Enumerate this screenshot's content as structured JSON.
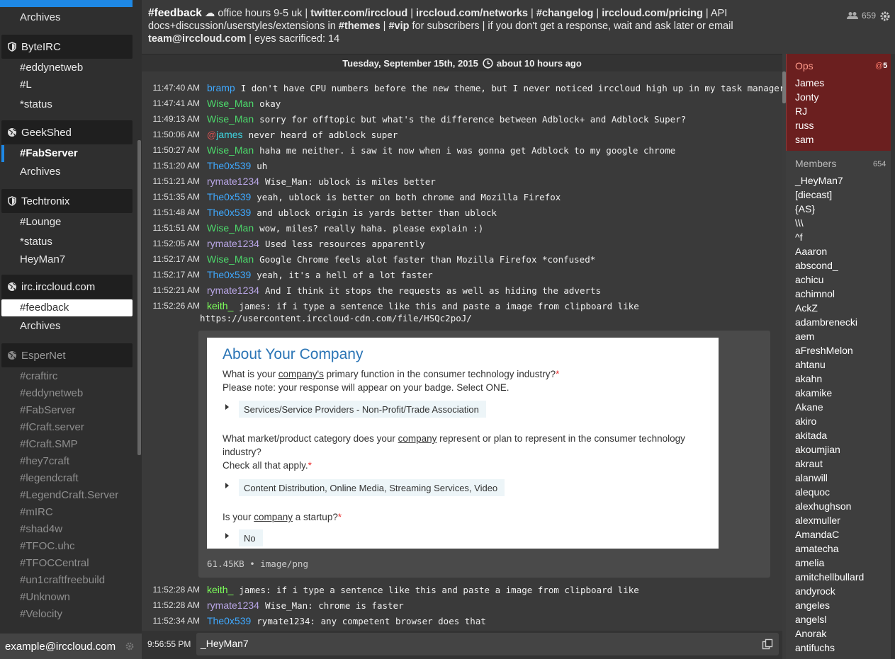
{
  "sidebar": {
    "items": [
      {
        "kind": "buffer",
        "label": "Archives",
        "style": "normal"
      },
      {
        "kind": "network",
        "label": "ByteIRC",
        "icon": "shield-icon"
      },
      {
        "kind": "buffer",
        "label": "#eddynetweb",
        "style": "normal"
      },
      {
        "kind": "buffer",
        "label": "#L",
        "style": "normal"
      },
      {
        "kind": "buffer",
        "label": "*status",
        "style": "normal"
      },
      {
        "kind": "network",
        "label": "GeekShed",
        "icon": "globe-icon"
      },
      {
        "kind": "buffer",
        "label": "#FabServer",
        "style": "bold-selected"
      },
      {
        "kind": "buffer",
        "label": "Archives",
        "style": "normal"
      },
      {
        "kind": "network",
        "label": "Techtronix",
        "icon": "shield-icon"
      },
      {
        "kind": "buffer",
        "label": "#Lounge",
        "style": "normal"
      },
      {
        "kind": "buffer",
        "label": "*status",
        "style": "normal"
      },
      {
        "kind": "buffer",
        "label": "HeyMan7",
        "style": "normal"
      },
      {
        "kind": "network",
        "label": "irc.irccloud.com",
        "icon": "globe-icon"
      },
      {
        "kind": "buffer",
        "label": "#feedback",
        "style": "active"
      },
      {
        "kind": "buffer",
        "label": "Archives",
        "style": "normal"
      },
      {
        "kind": "network",
        "label": "EsperNet",
        "icon": "globe-icon",
        "disconnected": true
      },
      {
        "kind": "buffer",
        "label": "#craftirc",
        "style": "dim"
      },
      {
        "kind": "buffer",
        "label": "#eddynetweb",
        "style": "dim"
      },
      {
        "kind": "buffer",
        "label": "#FabServer",
        "style": "dim"
      },
      {
        "kind": "buffer",
        "label": "#fCraft.server",
        "style": "dim"
      },
      {
        "kind": "buffer",
        "label": "#fCraft.SMP",
        "style": "dim"
      },
      {
        "kind": "buffer",
        "label": "#hey7craft",
        "style": "dim"
      },
      {
        "kind": "buffer",
        "label": "#legendcraft",
        "style": "dim"
      },
      {
        "kind": "buffer",
        "label": "#LegendCraft.Server",
        "style": "dim"
      },
      {
        "kind": "buffer",
        "label": "#mIRC",
        "style": "dim"
      },
      {
        "kind": "buffer",
        "label": "#shad4w",
        "style": "dim"
      },
      {
        "kind": "buffer",
        "label": "#TFOC.uhc",
        "style": "dim"
      },
      {
        "kind": "buffer",
        "label": "#TFOCCentral",
        "style": "dim"
      },
      {
        "kind": "buffer",
        "label": "#un1craftfreebuild",
        "style": "dim"
      },
      {
        "kind": "buffer",
        "label": "#Unknown",
        "style": "dim"
      },
      {
        "kind": "buffer",
        "label": "#Velocity",
        "style": "dim"
      }
    ],
    "account": "example@irccloud.com"
  },
  "header": {
    "channel": "#feedback",
    "topic_parts": [
      {
        "t": " ☁ office hours 9-5 uk | ",
        "b": false
      },
      {
        "t": "twitter.com/irccloud",
        "b": true
      },
      {
        "t": " | ",
        "b": false
      },
      {
        "t": "irccloud.com/networks",
        "b": true
      },
      {
        "t": " | ",
        "b": false
      },
      {
        "t": "#changelog",
        "b": true
      },
      {
        "t": " | ",
        "b": false
      },
      {
        "t": "irccloud.com/pricing",
        "b": true
      },
      {
        "t": " | API docs+discussion/userstyles/extensions in ",
        "b": false
      },
      {
        "t": "#themes",
        "b": true
      },
      {
        "t": " | ",
        "b": false
      },
      {
        "t": "#vip",
        "b": true
      },
      {
        "t": " for subscribers | if you don't get a response, wait and ask later or email ",
        "b": false
      },
      {
        "t": "team@irccloud.com",
        "b": true
      },
      {
        "t": " | eyes sacrificed: 14",
        "b": false
      }
    ],
    "user_count": "659"
  },
  "datebar": {
    "date": "Tuesday, September 15th, 2015",
    "ago": "about 10 hours ago"
  },
  "colors": {
    "green": "#4cd96b",
    "blue": "#3fa9ff",
    "purple": "#b9a6e6",
    "brightgreen": "#7cff5a",
    "cyan": "#3fd5e0"
  },
  "messages": [
    {
      "ts": "11:47:40 AM",
      "nick": "bramp",
      "color": "blue",
      "text": "I don't have CPU numbers before the new theme, but I never noticed irccloud high up in my task manager"
    },
    {
      "ts": "11:47:41 AM",
      "nick": "Wise_Man",
      "color": "green",
      "text": "okay"
    },
    {
      "ts": "11:49:13 AM",
      "nick": "Wise_Man",
      "color": "green",
      "text": "sorry for offtopic but what's the difference between Adblock+ and Adblock Super?"
    },
    {
      "ts": "11:50:06 AM",
      "nick": "james",
      "color": "cyan",
      "op": true,
      "text": "never heard of adblock super"
    },
    {
      "ts": "11:50:27 AM",
      "nick": "Wise_Man",
      "color": "green",
      "text": "haha me neither. i saw it now when i was gonna get Adblock to my google chrome"
    },
    {
      "ts": "11:51:20 AM",
      "nick": "The0x539",
      "color": "blue",
      "text": "uh"
    },
    {
      "ts": "11:51:21 AM",
      "nick": "rymate1234",
      "color": "purple",
      "text": "Wise_Man: ublock is miles better"
    },
    {
      "ts": "11:51:35 AM",
      "nick": "The0x539",
      "color": "blue",
      "text": "yeah, ublock is better on both chrome and Mozilla Firefox"
    },
    {
      "ts": "11:51:48 AM",
      "nick": "The0x539",
      "color": "blue",
      "text": "and ublock origin is yards better than ublock"
    },
    {
      "ts": "11:51:51 AM",
      "nick": "Wise_Man",
      "color": "green",
      "text": "wow, miles? really haha. please explain :)"
    },
    {
      "ts": "11:52:05 AM",
      "nick": "rymate1234",
      "color": "purple",
      "text": "Used less resources apparently"
    },
    {
      "ts": "11:52:17 AM",
      "nick": "Wise_Man",
      "color": "green",
      "text": "Google Chrome feels alot faster than Mozilla Firefox *confused*"
    },
    {
      "ts": "11:52:17 AM",
      "nick": "The0x539",
      "color": "blue",
      "text": "yeah, it's a hell of a lot faster"
    },
    {
      "ts": "11:52:21 AM",
      "nick": "rymate1234",
      "color": "purple",
      "text": "And I think it stops the requests as well as hiding the adverts"
    },
    {
      "ts": "11:52:26 AM",
      "nick": "keith_",
      "color": "brightgreen",
      "text": "james: if i type a sentence like this and paste a image from clipboard like"
    },
    {
      "ts": "11:52:28 AM",
      "nick": "keith_",
      "color": "brightgreen",
      "text": "james: if i type a sentence like this and paste a image from clipboard like"
    },
    {
      "ts": "11:52:28 AM",
      "nick": "rymate1234",
      "color": "purple",
      "text": "Wise_Man: chrome is faster"
    },
    {
      "ts": "11:52:34 AM",
      "nick": "The0x539",
      "color": "blue",
      "text": "rymate1234: any competent browser does that"
    }
  ],
  "url_line": "https://usercontent.irccloud-cdn.com/file/HSQc2poJ/",
  "preview": {
    "heading": "About Your Company",
    "q1_pre": "What is your ",
    "q1_u": "company's",
    "q1_post": " primary function in the consumer technology industry?",
    "q1_note": "Please note: your response will appear on your badge. Select ONE.",
    "a1": "Services/Service Providers - Non-Profit/Trade Association",
    "q2_pre": "What market/product category does your ",
    "q2_u": "company",
    "q2_post": " represent or plan to represent in the consumer technology industry?",
    "q2_note": "Check all that apply.",
    "a2": "Content Distribution, Online Media, Streaming Services, Video",
    "q3_pre": "Is your ",
    "q3_u": "company",
    "q3_post": " a startup?",
    "a3": "No",
    "required_mark": "*",
    "meta": "61.45KB • image/png"
  },
  "input": {
    "ts": "9:56:55 PM",
    "value": "_HeyMan7"
  },
  "ops": {
    "title": "Ops",
    "count": "5",
    "names": [
      "James",
      "Jonty",
      "RJ",
      "russ",
      "sam"
    ]
  },
  "members": {
    "title": "Members",
    "count": "654",
    "names": [
      "_HeyMan7",
      "[diecast]",
      "{AS}",
      "\\\\\\",
      "^f",
      "Aaaron",
      "abscond_",
      "achicu",
      "achimnol",
      "AckZ",
      "adambrenecki",
      "aem",
      "aFreshMelon",
      "ahtanu",
      "akahn",
      "akamike",
      "Akane",
      "akiro",
      "akitada",
      "akoumjian",
      "akraut",
      "alanwill",
      "alequoc",
      "alexhughson",
      "alexmuller",
      "AmandaC",
      "amatecha",
      "amelia",
      "amitchellbullard",
      "andyrock",
      "angeles",
      "angelsl",
      "Anorak",
      "antifuchs"
    ]
  }
}
